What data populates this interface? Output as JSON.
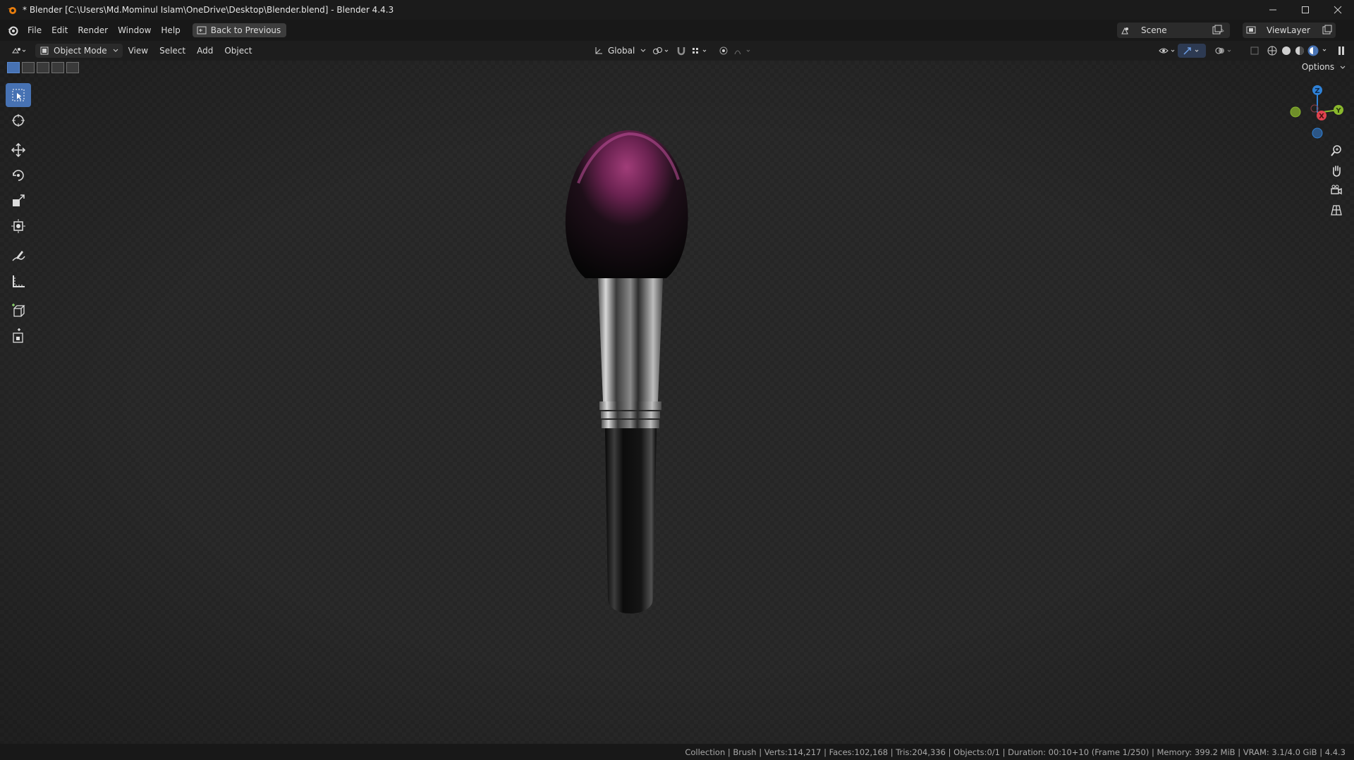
{
  "window": {
    "title": "* Blender [C:\\Users\\Md.Mominul Islam\\OneDrive\\Desktop\\Blender.blend] - Blender 4.4.3"
  },
  "menu": {
    "items": [
      "File",
      "Edit",
      "Render",
      "Window",
      "Help"
    ],
    "back_button": "Back to Previous"
  },
  "scene": {
    "scene_name": "Scene",
    "view_layer": "ViewLayer"
  },
  "viewport_header": {
    "mode": "Object Mode",
    "menus": [
      "View",
      "Select",
      "Add",
      "Object"
    ],
    "orientation": "Global",
    "options_label": "Options"
  },
  "gizmo": {
    "z": "Z",
    "y": "Y",
    "x": "X"
  },
  "status_bar": {
    "text": "Collection | Brush | Verts:114,217 | Faces:102,168 | Tris:204,336 | Objects:0/1 | Duration: 00:10+10 (Frame 1/250) | Memory: 399.2 MiB | VRAM: 3.1/4.0 GiB | 4.4.3"
  },
  "colors": {
    "accent": "#4772b3",
    "axis_x": "#e0424f",
    "axis_y": "#8ab82d",
    "axis_z": "#2f82d8"
  },
  "icons": {
    "toolbar": [
      "select-box-icon",
      "cursor-icon",
      "move-icon",
      "rotate-icon",
      "scale-icon",
      "transform-icon",
      "annotate-icon",
      "measure-icon",
      "add-cube-icon",
      "add-object-icon"
    ],
    "navigation": [
      "zoom-icon",
      "pan-hand-icon",
      "camera-icon",
      "grid-ortho-icon"
    ]
  }
}
